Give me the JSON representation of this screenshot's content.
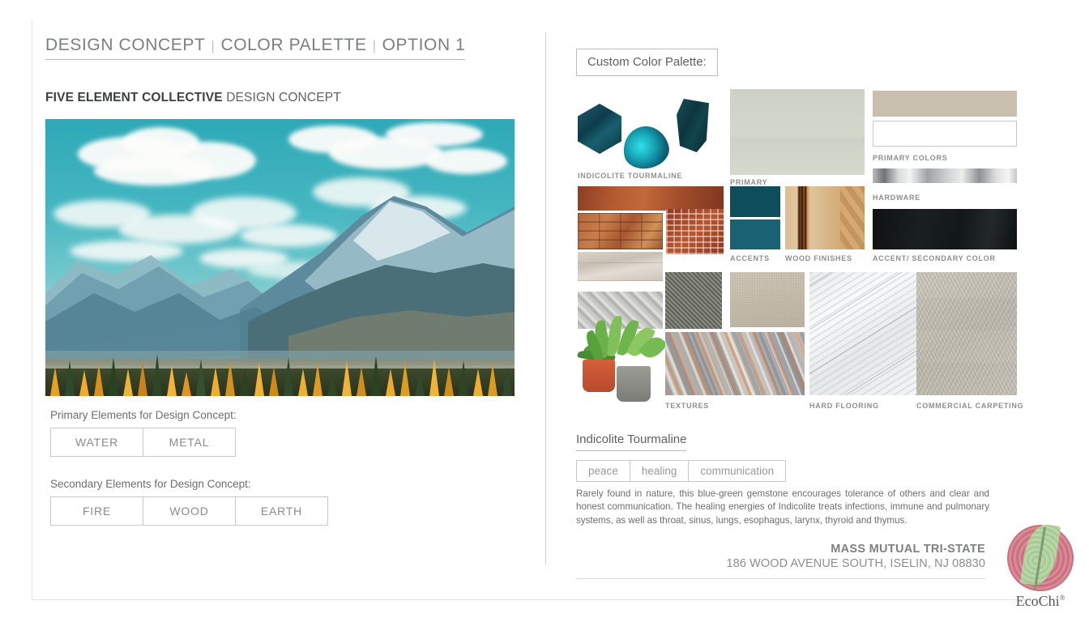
{
  "header": {
    "breadcrumb": [
      "DESIGN CONCEPT",
      "COLOR PALETTE",
      "OPTION 1"
    ],
    "separator": "|",
    "subtitle_bold": "FIVE ELEMENT COLLECTIVE",
    "subtitle_rest": " DESIGN CONCEPT"
  },
  "hero": {
    "alt": "mountain-landscape-photo"
  },
  "elements": {
    "primary_label": "Primary Elements for Design Concept:",
    "primary": [
      "WATER",
      "METAL"
    ],
    "secondary_label": "Secondary Elements for Design Concept:",
    "secondary": [
      "FIRE",
      "WOOD",
      "EARTH"
    ]
  },
  "palette": {
    "header": "Custom Color Palette:",
    "captions": {
      "gems": "INDICOLITE TOURMALINE",
      "primary": "PRIMARY",
      "primary_colors": "PRIMARY COLORS",
      "hardware": "HARDWARE",
      "accents": "ACCENTS",
      "wood_finishes": "WOOD FINISHES",
      "accent_secondary": "ACCENT/ SECONDARY COLOR",
      "textures": "TEXTURES",
      "hard_flooring": "HARD FLOORING",
      "commercial_carpeting": "COMMERCIAL CARPETING"
    },
    "colors": {
      "primary_wall": "#d4d7cc",
      "taupe": "#c8bfaf",
      "white": "#ffffff",
      "accent_dark_teal": "#0d4d5c",
      "accent_teal": "#186273",
      "accent_secondary_dark": "#151a1b",
      "hardware_chrome": "#c4c7c8"
    }
  },
  "gemstone": {
    "title": "Indicolite Tourmaline",
    "tags": [
      "peace",
      "healing",
      "communication"
    ],
    "description": "Rarely found in nature, this blue-green gemstone encourages tolerance of others and clear and honest communication. The healing energies of Indicolite treats infections, immune and pulmonary systems, as well as throat, sinus, lungs, esophagus, larynx, thyroid and thymus."
  },
  "footer": {
    "company": "MASS MUTUAL TRI-STATE",
    "address": "186 WOOD AVENUE SOUTH, ISELIN, NJ 08830",
    "logo_text": "EcoChi",
    "logo_mark": "®"
  }
}
